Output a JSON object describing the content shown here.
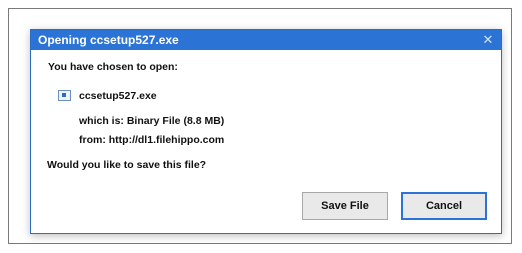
{
  "dialog": {
    "title": "Opening ccsetup527.exe",
    "close_glyph": "✕",
    "prompt": "You have chosen to open:",
    "file_name": "ccsetup527.exe",
    "type_line": "which is: Binary File (8.8 MB)",
    "from_line": "from: http://dl1.filehippo.com",
    "question": "Would you like to save this file?",
    "buttons": {
      "save_label": "Save File",
      "cancel_label": "Cancel"
    }
  },
  "icons": {
    "close": "close-icon",
    "file": "file-icon"
  },
  "colors": {
    "titlebar": "#2b74d6",
    "focus_border": "#2b74d6"
  }
}
